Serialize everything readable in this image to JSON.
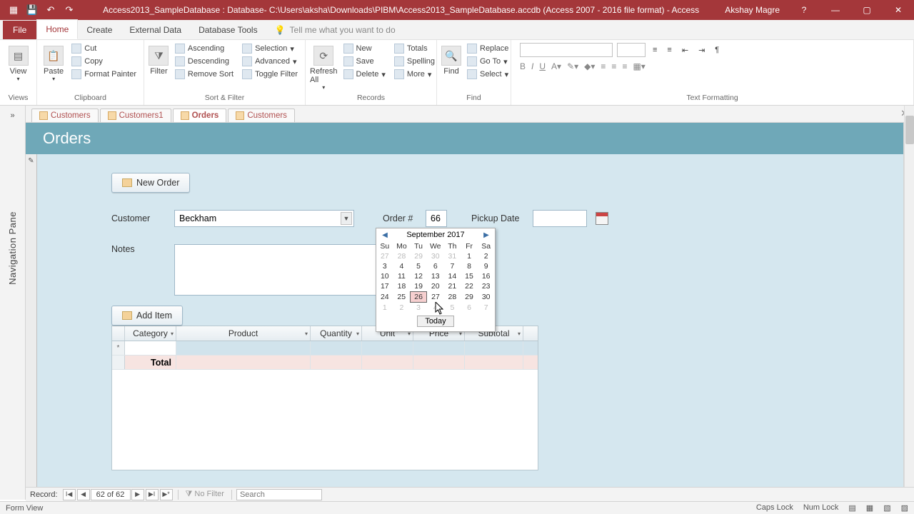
{
  "titlebar": {
    "title": "Access2013_SampleDatabase : Database- C:\\Users\\aksha\\Downloads\\PIBM\\Access2013_SampleDatabase.accdb (Access 2007 - 2016 file format) -  Access",
    "user": "Akshay Magre"
  },
  "ribbon_tabs": {
    "file": "File",
    "home": "Home",
    "create": "Create",
    "external": "External Data",
    "dbtools": "Database Tools",
    "tellme": "Tell me what you want to do"
  },
  "ribbon": {
    "views": {
      "view": "View",
      "label": "Views"
    },
    "clipboard": {
      "paste": "Paste",
      "cut": "Cut",
      "copy": "Copy",
      "painter": "Format Painter",
      "label": "Clipboard"
    },
    "sortfilter": {
      "filter": "Filter",
      "asc": "Ascending",
      "desc": "Descending",
      "remove": "Remove Sort",
      "selection": "Selection",
      "advanced": "Advanced",
      "toggle": "Toggle Filter",
      "label": "Sort & Filter"
    },
    "records": {
      "refresh": "Refresh All",
      "new": "New",
      "save": "Save",
      "delete": "Delete",
      "totals": "Totals",
      "spelling": "Spelling",
      "more": "More",
      "label": "Records"
    },
    "find": {
      "find": "Find",
      "replace": "Replace",
      "goto": "Go To",
      "select": "Select",
      "label": "Find"
    },
    "textfmt": {
      "label": "Text Formatting"
    }
  },
  "nav": {
    "label": "Navigation Pane",
    "collapse": "»"
  },
  "objtabs": {
    "t1": "Customers",
    "t2": "Customers1",
    "t3": "Orders",
    "t4": "Customers"
  },
  "form": {
    "title": "Orders",
    "neworder": "New Order",
    "customer_label": "Customer",
    "customer_value": "Beckham",
    "order_label": "Order #",
    "order_value": "66",
    "pickup_label": "Pickup Date",
    "notes_label": "Notes",
    "additem": "Add Item",
    "cols": {
      "category": "Category",
      "product": "Product",
      "quantity": "Quantity",
      "unit": "\"Unit\"",
      "price": "Price",
      "subtotal": "Subtotal"
    },
    "total": "Total"
  },
  "calendar": {
    "month": "September 2017",
    "dow": [
      "Su",
      "Mo",
      "Tu",
      "We",
      "Th",
      "Fr",
      "Sa"
    ],
    "weeks": [
      [
        {
          "d": "27",
          "o": true
        },
        {
          "d": "28",
          "o": true
        },
        {
          "d": "29",
          "o": true
        },
        {
          "d": "30",
          "o": true
        },
        {
          "d": "31",
          "o": true
        },
        {
          "d": "1"
        },
        {
          "d": "2"
        }
      ],
      [
        {
          "d": "3"
        },
        {
          "d": "4"
        },
        {
          "d": "5"
        },
        {
          "d": "6"
        },
        {
          "d": "7"
        },
        {
          "d": "8"
        },
        {
          "d": "9"
        }
      ],
      [
        {
          "d": "10"
        },
        {
          "d": "11"
        },
        {
          "d": "12"
        },
        {
          "d": "13"
        },
        {
          "d": "14"
        },
        {
          "d": "15"
        },
        {
          "d": "16"
        }
      ],
      [
        {
          "d": "17"
        },
        {
          "d": "18"
        },
        {
          "d": "19"
        },
        {
          "d": "20"
        },
        {
          "d": "21"
        },
        {
          "d": "22"
        },
        {
          "d": "23"
        }
      ],
      [
        {
          "d": "24"
        },
        {
          "d": "25"
        },
        {
          "d": "26",
          "sel": true
        },
        {
          "d": "27"
        },
        {
          "d": "28"
        },
        {
          "d": "29"
        },
        {
          "d": "30"
        }
      ],
      [
        {
          "d": "1",
          "o": true
        },
        {
          "d": "2",
          "o": true
        },
        {
          "d": "3",
          "o": true
        },
        {
          "d": "4",
          "o": true
        },
        {
          "d": "5",
          "o": true
        },
        {
          "d": "6",
          "o": true
        },
        {
          "d": "7",
          "o": true
        }
      ]
    ],
    "today": "Today"
  },
  "recnav": {
    "label": "Record:",
    "pos": "62 of 62",
    "nofilter": "No Filter",
    "search": "Search"
  },
  "status": {
    "left": "Form View",
    "caps": "Caps Lock",
    "num": "Num Lock"
  }
}
